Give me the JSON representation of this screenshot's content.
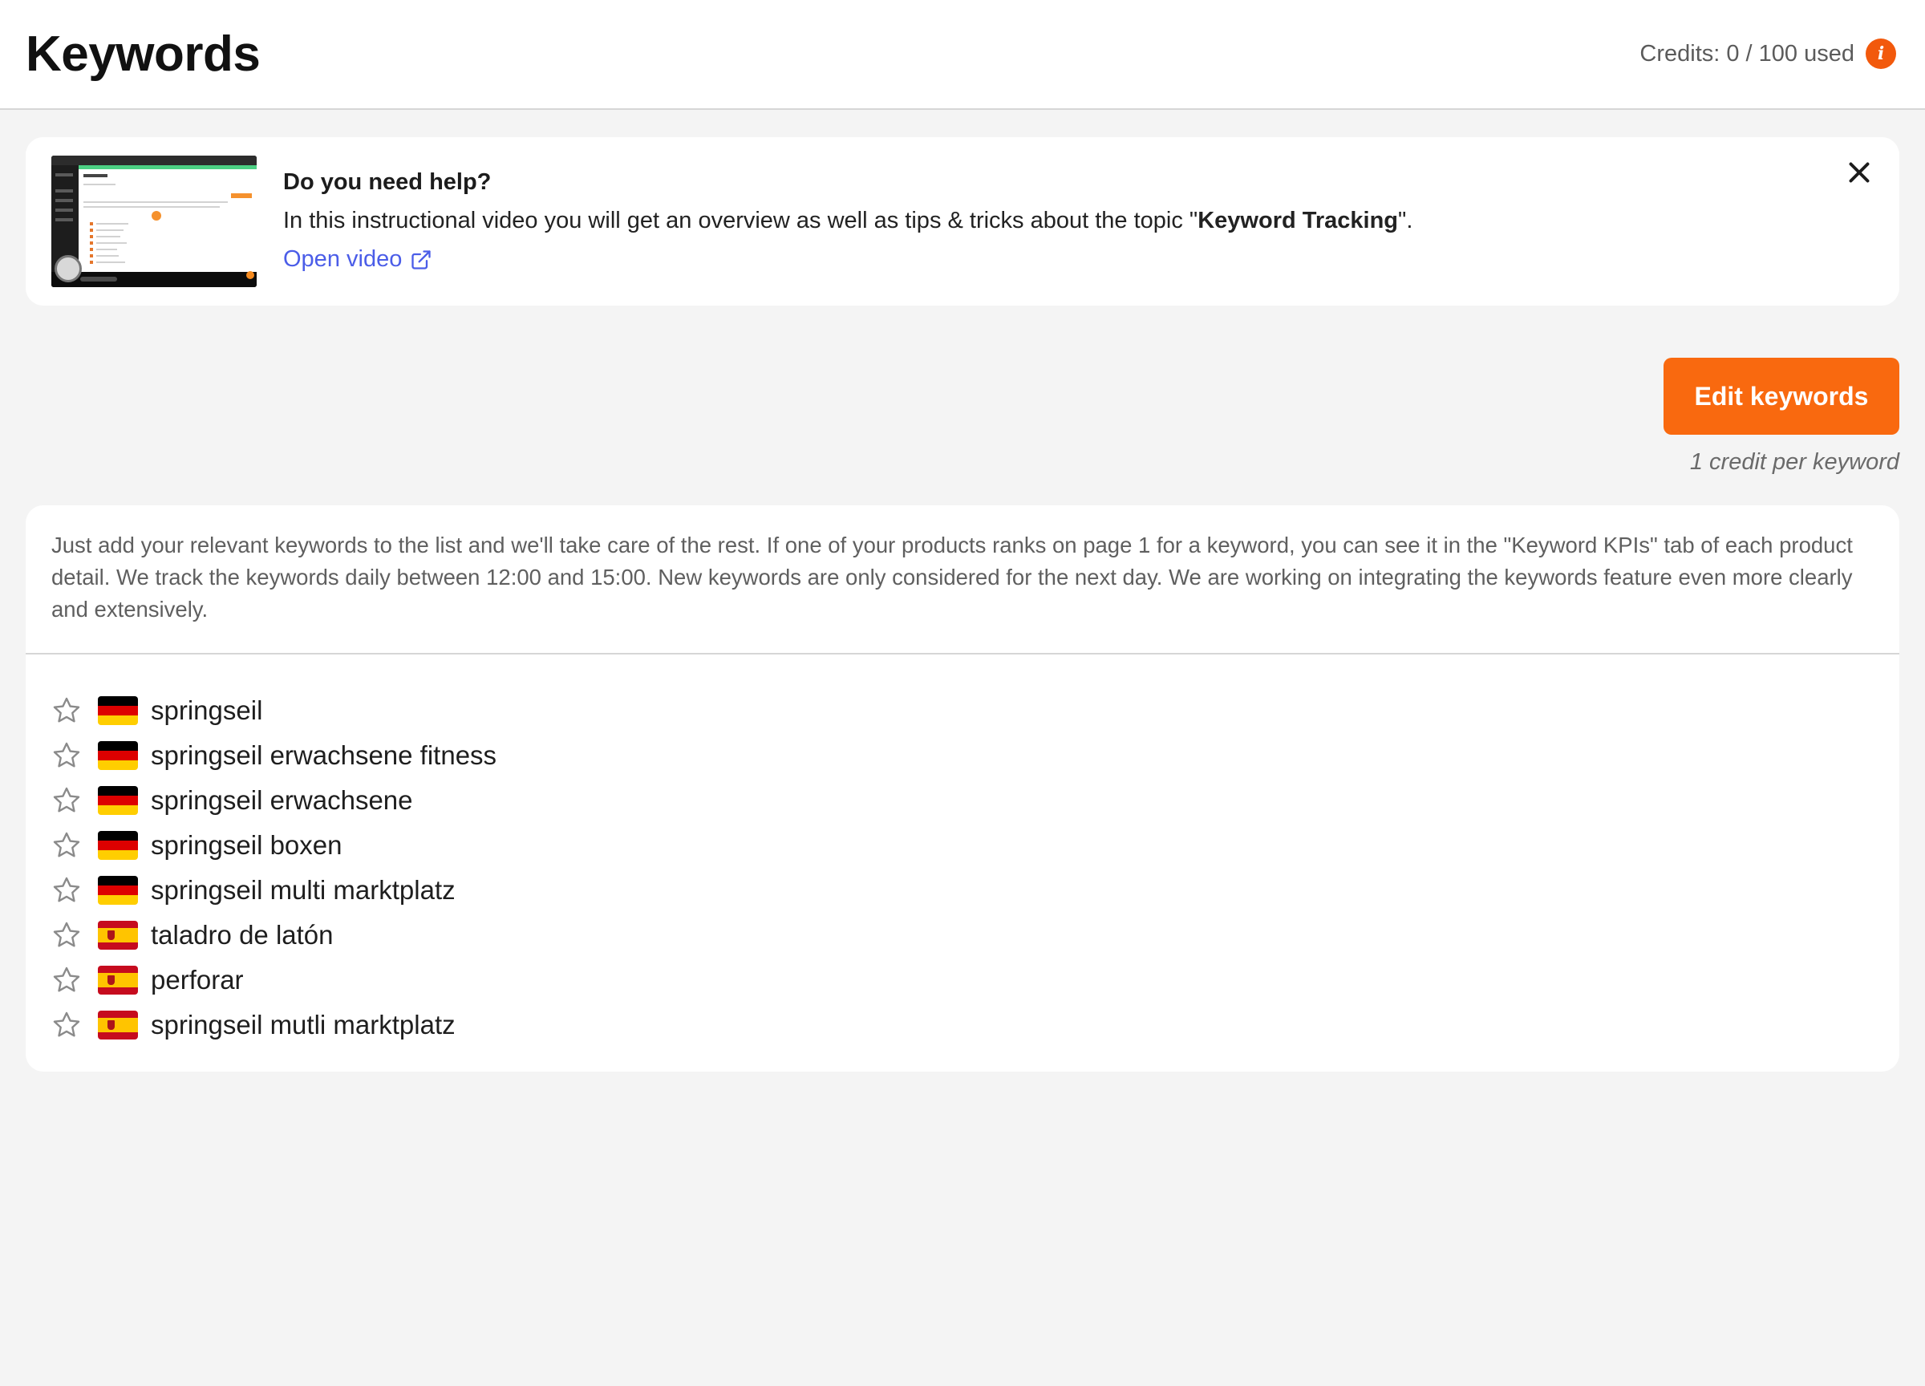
{
  "header": {
    "title": "Keywords",
    "credits_text": "Credits: 0 / 100 used",
    "info_icon": "info-icon",
    "accent_color": "#f2590c"
  },
  "help_banner": {
    "title": "Do you need help?",
    "description_before": "In this instructional video you will get an overview as well as tips & tricks about the topic \"",
    "description_bold": "Keyword Tracking",
    "description_after": "\".",
    "link_label": "Open video",
    "link_icon": "external-link-icon",
    "close_icon": "close-icon",
    "link_color": "#4b5de8"
  },
  "actions": {
    "edit_label": "Edit keywords",
    "credit_note": "1 credit per keyword",
    "button_color": "#f9690f"
  },
  "keywords_panel": {
    "info_text": "Just add your relevant keywords to the list and we'll take care of the rest. If one of your products ranks on page 1 for a keyword, you can see it in the \"Keyword KPIs\" tab of each product detail. We track the keywords daily between 12:00 and 15:00. New keywords are only considered for the next day. We are working on integrating the keywords feature even more clearly and extensively.",
    "items": [
      {
        "label": "springseil",
        "flag": "de",
        "icon": "star-outline-icon"
      },
      {
        "label": "springseil erwachsene fitness",
        "flag": "de",
        "icon": "star-outline-icon"
      },
      {
        "label": "springseil erwachsene",
        "flag": "de",
        "icon": "star-outline-icon"
      },
      {
        "label": "springseil boxen",
        "flag": "de",
        "icon": "star-outline-icon"
      },
      {
        "label": "springseil multi marktplatz",
        "flag": "de",
        "icon": "star-outline-icon"
      },
      {
        "label": "taladro de latón",
        "flag": "es",
        "icon": "star-outline-icon"
      },
      {
        "label": "perforar",
        "flag": "es",
        "icon": "star-outline-icon"
      },
      {
        "label": "springseil mutli marktplatz",
        "flag": "es",
        "icon": "star-outline-icon"
      }
    ]
  }
}
